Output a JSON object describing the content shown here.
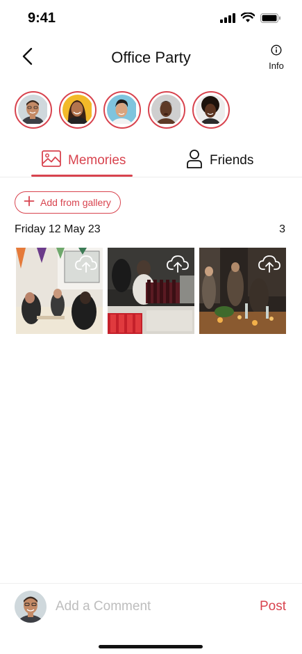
{
  "status_bar": {
    "time": "9:41"
  },
  "nav": {
    "title": "Office Party",
    "info_label": "Info"
  },
  "avatars": [
    {
      "name": "avatar-1",
      "bg": "#cfd8dc",
      "skin": "#c48a66",
      "hair": "#3b2a20"
    },
    {
      "name": "avatar-2",
      "bg": "#f2b929",
      "skin": "#b3744d",
      "hair": "#3a2216"
    },
    {
      "name": "avatar-3",
      "bg": "#7fc4dd",
      "skin": "#d8a47f",
      "hair": "#1e1a18"
    },
    {
      "name": "avatar-4",
      "bg": "#cfcfcf",
      "skin": "#5e3a26",
      "hair": "#2a1a10"
    },
    {
      "name": "avatar-5",
      "bg": "#ececec",
      "skin": "#5a3320",
      "hair": "#1c120c"
    }
  ],
  "tabs": {
    "memories": "Memories",
    "friends": "Friends"
  },
  "gallery": {
    "add_label": "Add from gallery"
  },
  "group": {
    "date": "Friday 12 May 23",
    "count": "3"
  },
  "comment": {
    "placeholder": "Add a Comment",
    "post_label": "Post"
  },
  "colors": {
    "accent": "#d8434e"
  }
}
